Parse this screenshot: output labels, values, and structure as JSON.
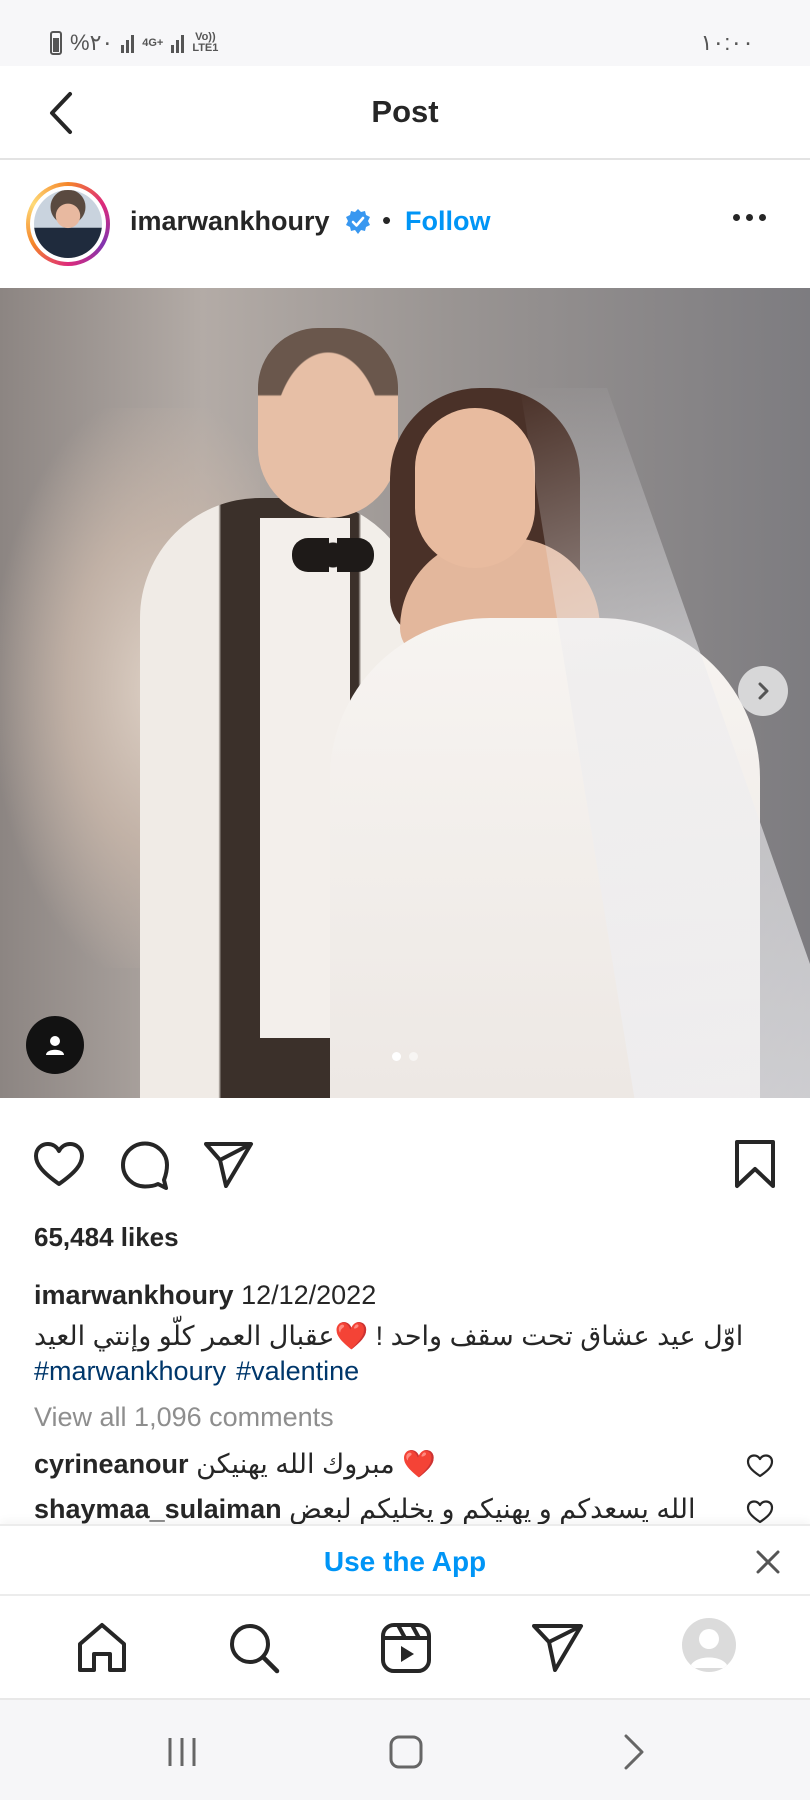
{
  "status_bar": {
    "battery_text": "%٢٠",
    "network_1": "4G+",
    "network_2": "Vo))\nLTE1",
    "time": "١٠:٠٠"
  },
  "header": {
    "title": "Post",
    "back_icon": "chevron-left-icon"
  },
  "post": {
    "username": "imarwankhoury",
    "verified": true,
    "separator": "•",
    "follow_label": "Follow",
    "more_icon": "more-horizontal-icon",
    "carousel": {
      "current": 1,
      "total": 2
    }
  },
  "actions": {
    "like_icon": "heart-icon",
    "comment_icon": "comment-icon",
    "share_icon": "send-icon",
    "save_icon": "bookmark-icon"
  },
  "likes_text": "65,484 likes",
  "caption": {
    "username": "imarwankhoury",
    "date": "12/12/2022",
    "text": "اوّل عيد عشاق تحت سقف واحد ! ❤️عقبال العمر كلّو وإنتي العيد",
    "hashtags": [
      "#marwankhoury",
      "#valentine"
    ]
  },
  "view_all_comments": "View all 1,096 comments",
  "comments": [
    {
      "username": "cyrineanour",
      "text": "مبروك الله يهنيكن ❤️"
    },
    {
      "username": "shaymaa_sulaiman",
      "text": "الله يسعدكم و يهنيكم و يخليكم لبعض"
    }
  ],
  "banner": {
    "label": "Use the App"
  },
  "bottom_nav": [
    "home-icon",
    "search-icon",
    "reels-icon",
    "direct-icon",
    "profile-avatar"
  ],
  "colors": {
    "accent": "#0095f6",
    "hashtag": "#00376b",
    "muted": "#8e8e8e",
    "verified": "#3897f0"
  }
}
